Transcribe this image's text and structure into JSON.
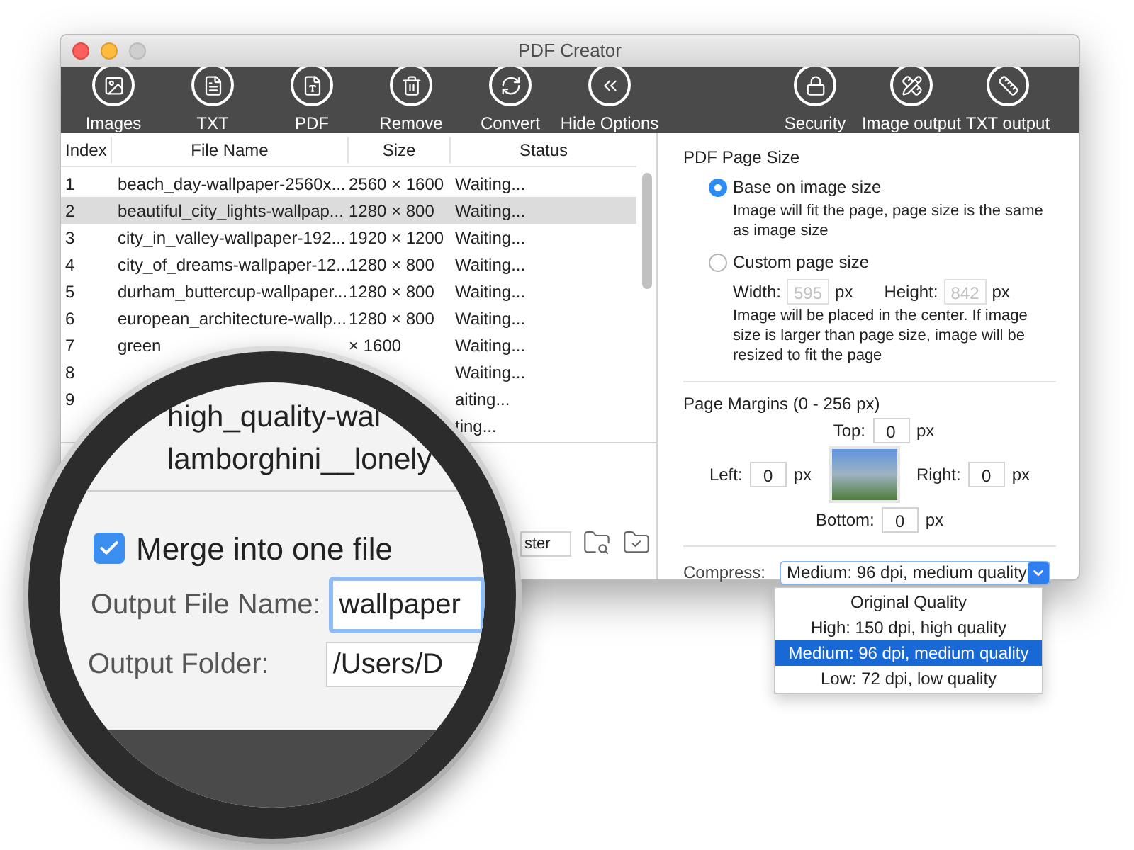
{
  "window": {
    "title": "PDF Creator"
  },
  "toolbar": {
    "left": [
      {
        "label": "Images"
      },
      {
        "label": "TXT"
      },
      {
        "label": "PDF"
      },
      {
        "label": "Remove"
      },
      {
        "label": "Convert"
      },
      {
        "label": "Hide Options"
      }
    ],
    "right": [
      {
        "label": "Security"
      },
      {
        "label": "Image output"
      },
      {
        "label": "TXT output"
      }
    ]
  },
  "table": {
    "columns": [
      "Index",
      "File Name",
      "Size",
      "Status"
    ],
    "rows": [
      {
        "index": "1",
        "file_name": "beach_day-wallpaper-2560x...",
        "size": "2560 × 1600",
        "status": "Waiting...",
        "selected": false
      },
      {
        "index": "2",
        "file_name": "beautiful_city_lights-wallpap...",
        "size": "1280 × 800",
        "status": "Waiting...",
        "selected": true
      },
      {
        "index": "3",
        "file_name": "city_in_valley-wallpaper-192...",
        "size": "1920 × 1200",
        "status": "Waiting...",
        "selected": false
      },
      {
        "index": "4",
        "file_name": "city_of_dreams-wallpaper-12...",
        "size": "1280 × 800",
        "status": "Waiting...",
        "selected": false
      },
      {
        "index": "5",
        "file_name": "durham_buttercup-wallpaper...",
        "size": "1280 × 800",
        "status": "Waiting...",
        "selected": false
      },
      {
        "index": "6",
        "file_name": "european_architecture-wallp...",
        "size": "1280 × 800",
        "status": "Waiting...",
        "selected": false
      },
      {
        "index": "7",
        "file_name": "green",
        "size": "× 1600",
        "status": "Waiting...",
        "selected": false
      },
      {
        "index": "8",
        "status": "Waiting...",
        "selected": false
      },
      {
        "index": "9",
        "status": "aiting...",
        "selected": false
      },
      {
        "status": "ting...",
        "selected": false
      }
    ]
  },
  "output_folder_field": {
    "value": "ster"
  },
  "magnifier": {
    "lines": [
      "high_quality-wal",
      "lamborghini__lonely"
    ],
    "merge": {
      "label": "Merge into one file",
      "checked": true
    },
    "file_name": {
      "label": "Output File Name:",
      "value": "wallpaper"
    },
    "folder": {
      "label": "Output Folder:",
      "value": "/Users/D"
    }
  },
  "page_size": {
    "title": "PDF Page Size",
    "options": [
      {
        "label": "Base on image size",
        "selected": true,
        "note": "Image will fit the page, page size is the same as image size"
      },
      {
        "label": "Custom page size",
        "selected": false,
        "note": "Image will be placed in the center. If image size is larger than page size, image will be resized to fit the page"
      }
    ],
    "custom_disabled": true,
    "width": {
      "label": "Width:",
      "value": "595",
      "unit": "px"
    },
    "height": {
      "label": "Height:",
      "value": "842",
      "unit": "px"
    }
  },
  "margins": {
    "title": "Page Margins (0 - 256 px)",
    "top": {
      "label": "Top:",
      "value": "0",
      "unit": "px"
    },
    "left": {
      "label": "Left:",
      "value": "0",
      "unit": "px"
    },
    "right": {
      "label": "Right:",
      "value": "0",
      "unit": "px"
    },
    "bottom": {
      "label": "Bottom:",
      "value": "0",
      "unit": "px"
    }
  },
  "compress": {
    "label": "Compress:",
    "value": "Medium: 96 dpi, medium quality",
    "expanded": true,
    "options": [
      {
        "label": "Original Quality",
        "selected": false
      },
      {
        "label": "High: 150 dpi, high quality",
        "selected": false
      },
      {
        "label": "Medium: 96 dpi, medium quality",
        "selected": true
      },
      {
        "label": "Low: 72 dpi, low quality",
        "selected": false
      }
    ]
  }
}
